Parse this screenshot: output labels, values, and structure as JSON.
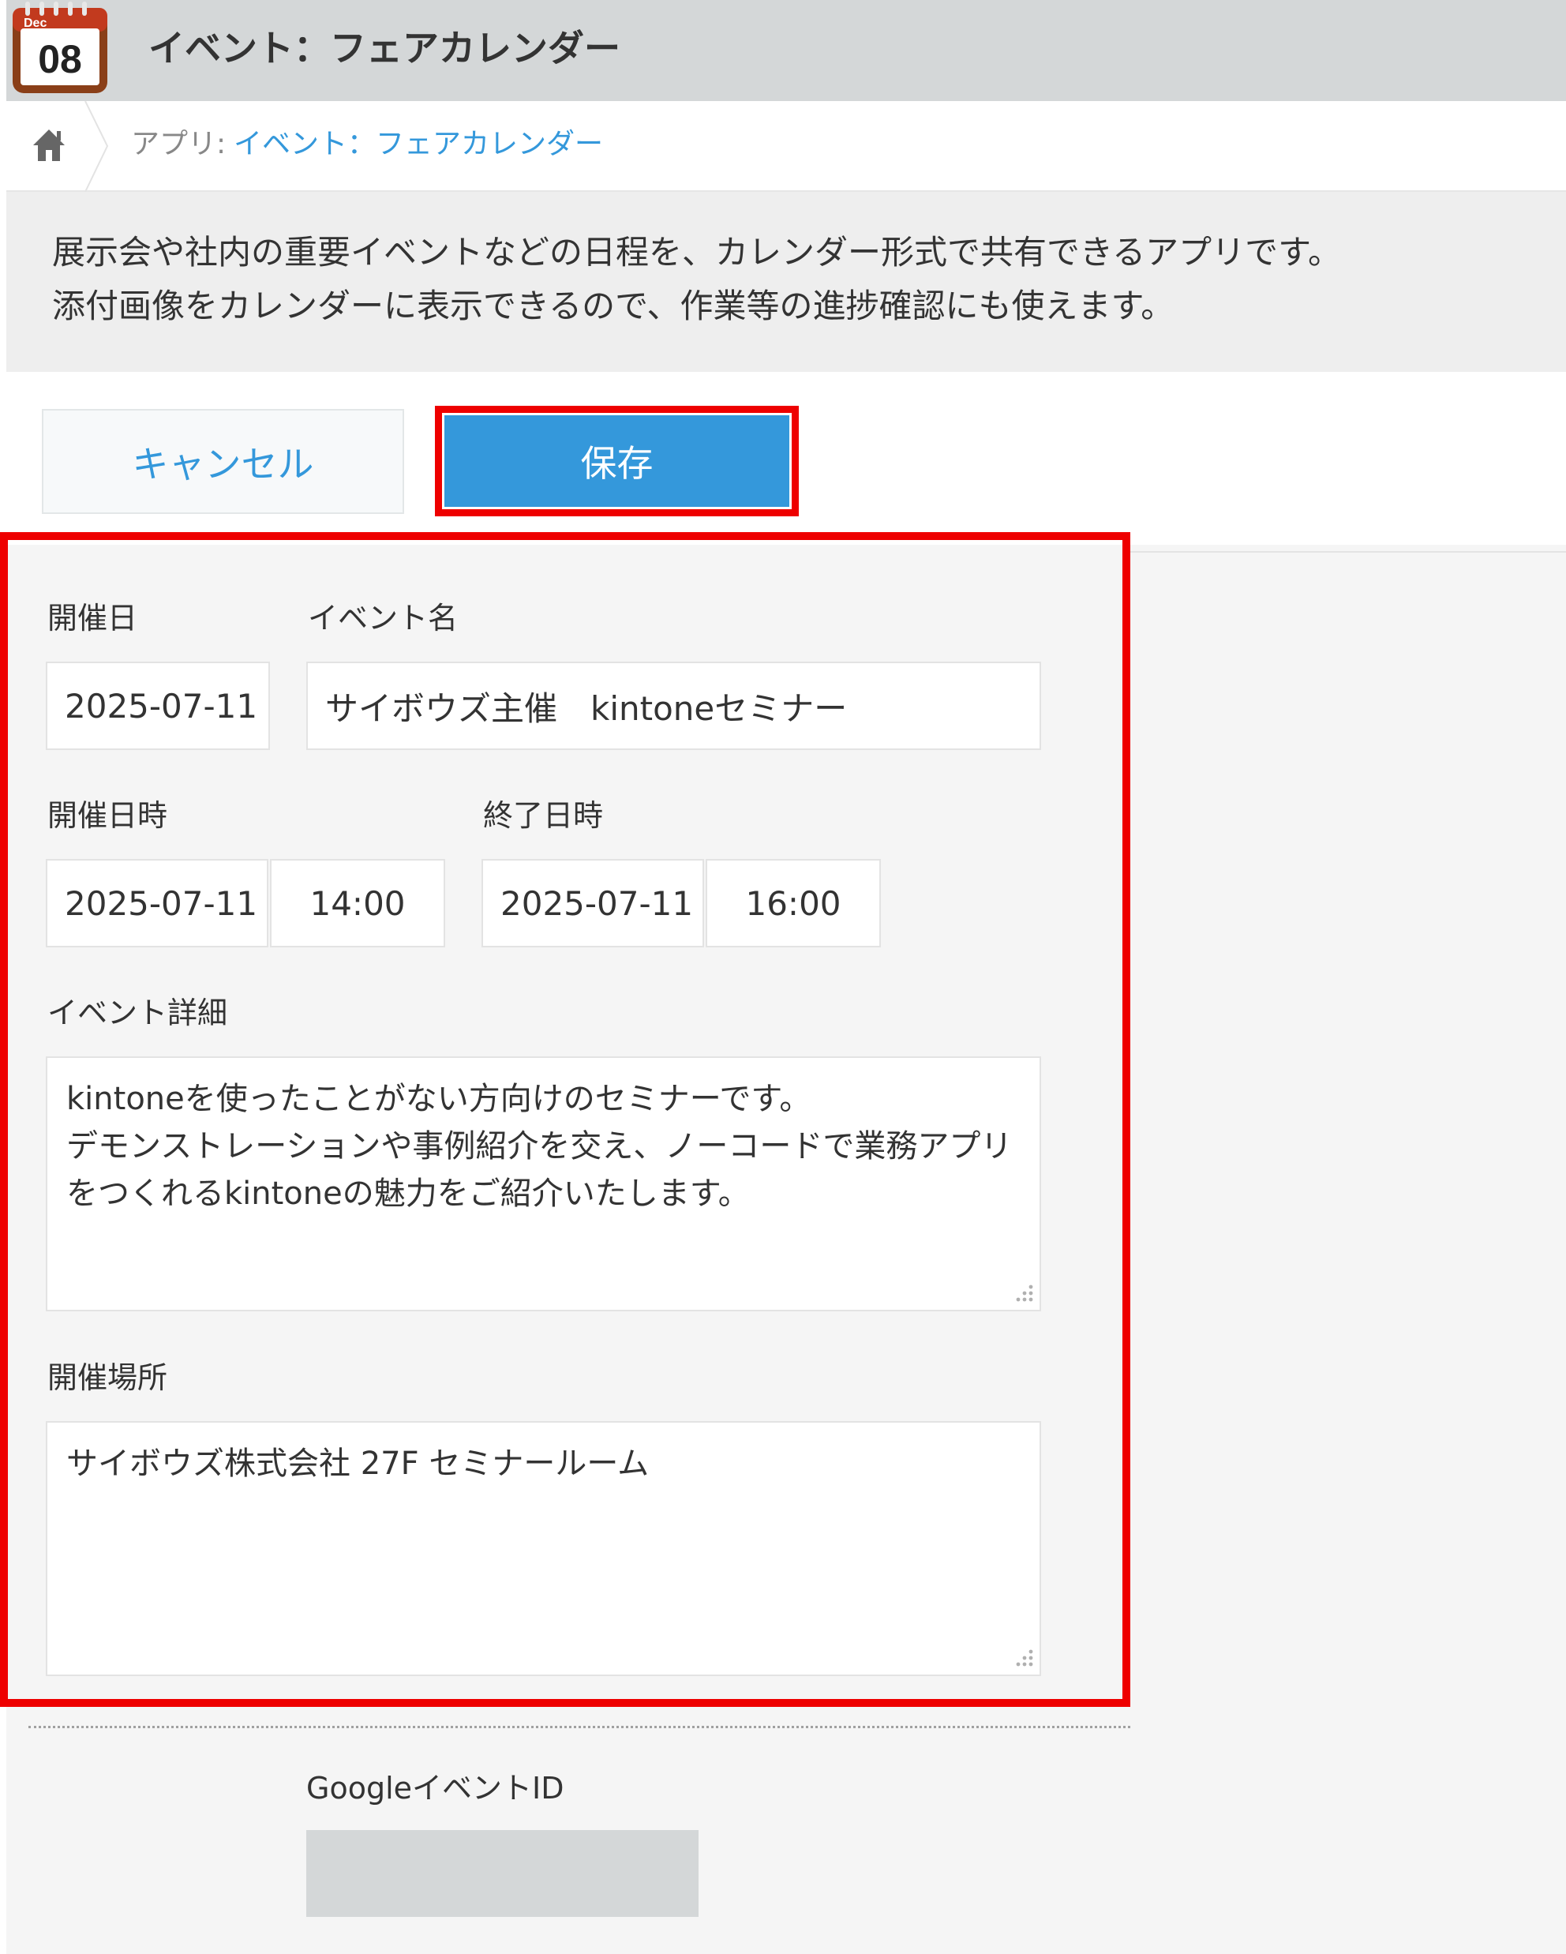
{
  "header": {
    "app_icon": {
      "month": "Dec",
      "day": "08",
      "icon": "calendar-icon"
    },
    "title": "イベント：フェアカレンダー"
  },
  "breadcrumb": {
    "home_icon": "home-icon",
    "prefix": "アプリ:",
    "app_link": "イベント：フェアカレンダー"
  },
  "description": {
    "line1": "展示会や社内の重要イベントなどの日程を、カレンダー形式で共有できるアプリです。",
    "line2": "添付画像をカレンダーに表示できるので、作業等の進捗確認にも使えます。"
  },
  "toolbar": {
    "cancel_label": "キャンセル",
    "save_label": "保存"
  },
  "form": {
    "event_date": {
      "label": "開催日",
      "value": "2025-07-11"
    },
    "event_name": {
      "label": "イベント名",
      "value": "サイボウズ主催　kintoneセミナー"
    },
    "start": {
      "label": "開催日時",
      "date": "2025-07-11",
      "time": "14:00"
    },
    "end": {
      "label": "終了日時",
      "date": "2025-07-11",
      "time": "16:00"
    },
    "details": {
      "label": "イベント詳細",
      "lines": [
        "kintoneを使ったことがない方向けのセミナーです。",
        "デモンストレーションや事例紹介を交え、ノーコードで業務アプリ",
        "をつくれるkintoneの魅力をご紹介いたします。"
      ]
    },
    "location": {
      "label": "開催場所",
      "value": "サイボウズ株式会社 27F セミナールーム"
    },
    "google_event_id": {
      "label": "GoogleイベントID",
      "value": ""
    }
  },
  "colors": {
    "accent": "#3498db",
    "highlight": "#ee0000",
    "header_bg": "#d4d7d8"
  }
}
